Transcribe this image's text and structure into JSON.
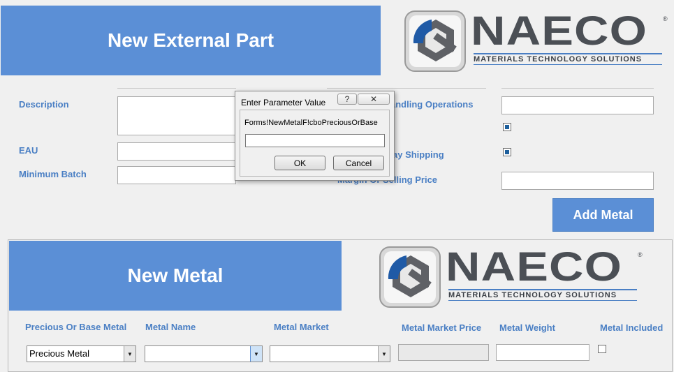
{
  "part_form": {
    "title": "New External Part",
    "labels": {
      "description": "Description",
      "eau": "EAU",
      "minimum_batch": "Minimum Batch",
      "handling_operations": "andling Operations",
      "way_shipping": "ay Shipping",
      "margin_selling_price": "Margin Or Selling Price"
    },
    "checkboxes": {
      "checkbox_1_checked": true,
      "checkbox_2_checked": true
    },
    "add_metal_button": "Add Metal"
  },
  "logo": {
    "word": "NAECO",
    "tagline": "MATERIALS TECHNOLOGY SOLUTIONS",
    "registered": "®"
  },
  "dialog": {
    "title": "Enter Parameter Value",
    "help_button": "?",
    "close_button": "✕",
    "prompt": "Forms!NewMetalF!cboPreciousOrBase",
    "input_value": "",
    "ok": "OK",
    "cancel": "Cancel"
  },
  "metal_form": {
    "title": "New Metal",
    "columns": {
      "precious_or_base": "Precious Or Base Metal",
      "metal_name": "Metal Name",
      "metal_market": "Metal Market",
      "metal_market_price": "Metal Market Price",
      "metal_weight": "Metal Weight",
      "metal_included": "Metal Included"
    },
    "precious_or_base_value": "Precious Metal",
    "metal_name_value": "",
    "metal_market_value": "",
    "metal_included_checked": false
  },
  "colors": {
    "banner_blue": "#5b8fd6",
    "label_blue": "#4a7fc4",
    "background": "#f0f0f0"
  }
}
